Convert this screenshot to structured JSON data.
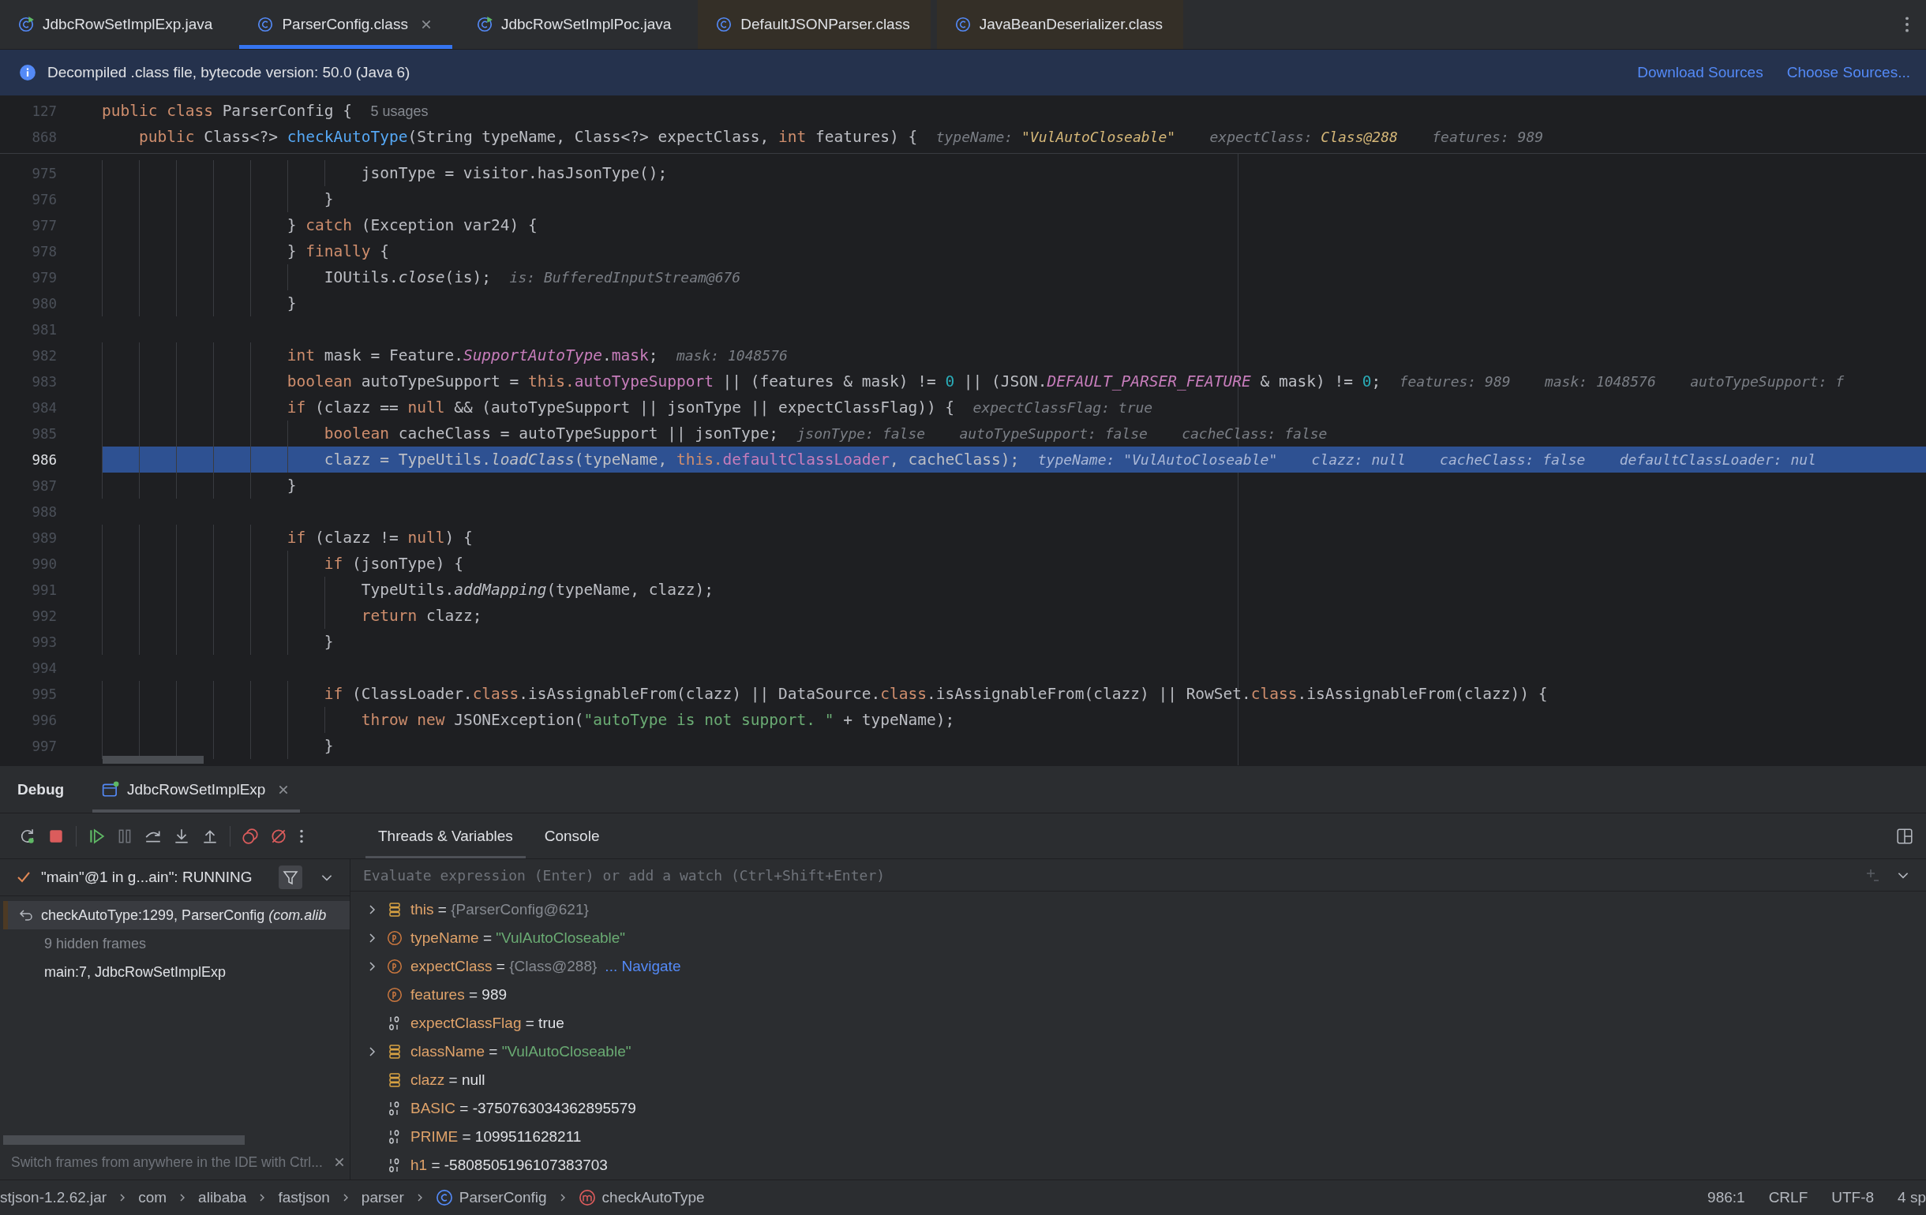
{
  "tabs": [
    {
      "label": "JdbcRowSetImplExp.java",
      "kind": "java",
      "selected": false,
      "closable": false,
      "color": "#2b2d30"
    },
    {
      "label": "ParserConfig.class",
      "kind": "class",
      "selected": true,
      "closable": true,
      "color": "#2b2d30"
    },
    {
      "label": "JdbcRowSetImplPoc.java",
      "kind": "java",
      "selected": false,
      "closable": false,
      "color": "#2b2d30"
    },
    {
      "label": "DefaultJSONParser.class",
      "kind": "class",
      "selected": false,
      "closable": false,
      "color": "#342f27"
    },
    {
      "label": "JavaBeanDeserializer.class",
      "kind": "class",
      "selected": false,
      "closable": false,
      "color": "#342f27"
    }
  ],
  "banner": {
    "text": "Decompiled .class file, bytecode version: 50.0 (Java 6)",
    "links": [
      "Download Sources",
      "Choose Sources..."
    ]
  },
  "sticky_lines": [
    {
      "number": "127",
      "tokens": [
        {
          "text": "public class",
          "kind": "kw"
        },
        {
          "text": " ParserConfig {",
          "kind": "plain"
        },
        {
          "text": "5 usages",
          "kind": "usage"
        }
      ]
    },
    {
      "number": "868",
      "tokens": [
        {
          "text": "    public",
          "kind": "kw"
        },
        {
          "text": " Class<?> ",
          "kind": "plain"
        },
        {
          "text": "checkAutoType",
          "kind": "decl"
        },
        {
          "text": "(String typeName, Class<?> expectClass, ",
          "kind": "plain"
        },
        {
          "text": "int",
          "kind": "kw"
        },
        {
          "text": " features) {",
          "kind": "plain"
        },
        {
          "text": "typeName: ",
          "kind": "hint"
        },
        {
          "text": "\"VulAutoCloseable\"",
          "kind": "hintval"
        },
        {
          "text": "    expectClass: ",
          "kind": "hint"
        },
        {
          "text": "Class@288",
          "kind": "hintval"
        },
        {
          "text": "    features: 989",
          "kind": "hint"
        }
      ]
    }
  ],
  "lines": [
    {
      "number": "975",
      "current": false,
      "tokens": [
        {
          "text": "                            jsonType = visitor.hasJsonType();",
          "kind": "plain"
        }
      ]
    },
    {
      "number": "976",
      "current": false,
      "tokens": [
        {
          "text": "                        }",
          "kind": "plain"
        }
      ]
    },
    {
      "number": "977",
      "current": false,
      "tokens": [
        {
          "text": "                    } ",
          "kind": "plain"
        },
        {
          "text": "catch",
          "kind": "kw"
        },
        {
          "text": " (Exception var24) {",
          "kind": "plain"
        }
      ]
    },
    {
      "number": "978",
      "current": false,
      "tokens": [
        {
          "text": "                    } ",
          "kind": "plain"
        },
        {
          "text": "finally",
          "kind": "kw"
        },
        {
          "text": " {",
          "kind": "plain"
        }
      ]
    },
    {
      "number": "979",
      "current": false,
      "tokens": [
        {
          "text": "                        IOUtils.",
          "kind": "plain"
        },
        {
          "text": "close",
          "kind": "smethod"
        },
        {
          "text": "(is);",
          "kind": "plain"
        },
        {
          "text": "is: BufferedInputStream@676",
          "kind": "hint"
        }
      ]
    },
    {
      "number": "980",
      "current": false,
      "tokens": [
        {
          "text": "                    }",
          "kind": "plain"
        }
      ]
    },
    {
      "number": "981",
      "current": false
    },
    {
      "number": "982",
      "current": false,
      "tokens": [
        {
          "text": "                    int",
          "kind": "kw"
        },
        {
          "text": " mask = Feature.",
          "kind": "plain"
        },
        {
          "text": "SupportAutoType",
          "kind": "sfield"
        },
        {
          "text": ".",
          "kind": "plain"
        },
        {
          "text": "mask",
          "kind": "field"
        },
        {
          "text": ";",
          "kind": "plain"
        },
        {
          "text": "mask: 1048576",
          "kind": "hint"
        }
      ]
    },
    {
      "number": "983",
      "current": false,
      "tokens": [
        {
          "text": "                    boolean",
          "kind": "kw"
        },
        {
          "text": " autoTypeSupport = ",
          "kind": "plain"
        },
        {
          "text": "this.",
          "kind": "kw"
        },
        {
          "text": "autoTypeSupport",
          "kind": "field"
        },
        {
          "text": " || (features & mask) != ",
          "kind": "plain"
        },
        {
          "text": "0",
          "kind": "num"
        },
        {
          "text": " || (JSON.",
          "kind": "plain"
        },
        {
          "text": "DEFAULT_PARSER_FEATURE",
          "kind": "sfield"
        },
        {
          "text": " & mask) != ",
          "kind": "plain"
        },
        {
          "text": "0",
          "kind": "num"
        },
        {
          "text": ";",
          "kind": "plain"
        },
        {
          "text": "features: 989    mask: 1048576    autoTypeSupport: f",
          "kind": "hint"
        }
      ]
    },
    {
      "number": "984",
      "current": false,
      "tokens": [
        {
          "text": "                    if",
          "kind": "kw"
        },
        {
          "text": " (clazz == ",
          "kind": "plain"
        },
        {
          "text": "null",
          "kind": "kw"
        },
        {
          "text": " && (autoTypeSupport || jsonType || expectClassFlag)) {",
          "kind": "plain"
        },
        {
          "text": "expectClassFlag: true",
          "kind": "hint"
        }
      ]
    },
    {
      "number": "985",
      "current": false,
      "tokens": [
        {
          "text": "                        boolean",
          "kind": "kw"
        },
        {
          "text": " cacheClass = autoTypeSupport || jsonType;",
          "kind": "plain"
        },
        {
          "text": "jsonType: false    autoTypeSupport: false    cacheClass: false",
          "kind": "hint"
        }
      ]
    },
    {
      "number": "986",
      "current": true,
      "tokens": [
        {
          "text": "                        clazz = TypeUtils.",
          "kind": "plain"
        },
        {
          "text": "loadClass",
          "kind": "smethod"
        },
        {
          "text": "(typeName, ",
          "kind": "plain"
        },
        {
          "text": "this.",
          "kind": "kw"
        },
        {
          "text": "defaultClassLoader",
          "kind": "field"
        },
        {
          "text": ", cacheClass);",
          "kind": "plain"
        },
        {
          "text": "typeName: \"VulAutoCloseable\"    clazz: null    cacheClass: false    defaultClassLoader: nul",
          "kind": "hint"
        }
      ]
    },
    {
      "number": "987",
      "current": false,
      "tokens": [
        {
          "text": "                    }",
          "kind": "plain"
        }
      ]
    },
    {
      "number": "988",
      "current": false
    },
    {
      "number": "989",
      "current": false,
      "tokens": [
        {
          "text": "                    if",
          "kind": "kw"
        },
        {
          "text": " (clazz != ",
          "kind": "plain"
        },
        {
          "text": "null",
          "kind": "kw"
        },
        {
          "text": ") {",
          "kind": "plain"
        }
      ]
    },
    {
      "number": "990",
      "current": false,
      "tokens": [
        {
          "text": "                        if",
          "kind": "kw"
        },
        {
          "text": " (jsonType) {",
          "kind": "plain"
        }
      ]
    },
    {
      "number": "991",
      "current": false,
      "tokens": [
        {
          "text": "                            TypeUtils.",
          "kind": "plain"
        },
        {
          "text": "addMapping",
          "kind": "smethod"
        },
        {
          "text": "(typeName, clazz);",
          "kind": "plain"
        }
      ]
    },
    {
      "number": "992",
      "current": false,
      "tokens": [
        {
          "text": "                            return",
          "kind": "kw"
        },
        {
          "text": " clazz;",
          "kind": "plain"
        }
      ]
    },
    {
      "number": "993",
      "current": false,
      "tokens": [
        {
          "text": "                        }",
          "kind": "plain"
        }
      ]
    },
    {
      "number": "994",
      "current": false
    },
    {
      "number": "995",
      "current": false,
      "tokens": [
        {
          "text": "                        if",
          "kind": "kw"
        },
        {
          "text": " (ClassLoader.",
          "kind": "plain"
        },
        {
          "text": "class",
          "kind": "kw"
        },
        {
          "text": ".isAssignableFrom(clazz) || DataSource.",
          "kind": "plain"
        },
        {
          "text": "class",
          "kind": "kw"
        },
        {
          "text": ".isAssignableFrom(clazz) || RowSet.",
          "kind": "plain"
        },
        {
          "text": "class",
          "kind": "kw"
        },
        {
          "text": ".isAssignableFrom(clazz)) {",
          "kind": "plain"
        }
      ]
    },
    {
      "number": "996",
      "current": false,
      "tokens": [
        {
          "text": "                            throw new",
          "kind": "kw"
        },
        {
          "text": " JSONException(",
          "kind": "plain"
        },
        {
          "text": "\"autoType is not support. \"",
          "kind": "str"
        },
        {
          "text": " + typeName);",
          "kind": "plain"
        }
      ]
    },
    {
      "number": "997",
      "current": false,
      "tokens": [
        {
          "text": "                        }",
          "kind": "plain"
        }
      ]
    }
  ],
  "debug": {
    "title": "Debug",
    "session_tab": "JdbcRowSetImplExp",
    "view_tabs": [
      {
        "label": "Threads & Variables",
        "selected": true
      },
      {
        "label": "Console",
        "selected": false
      }
    ],
    "thread": "\"main\"@1 in g...ain\": RUNNING",
    "frames": [
      {
        "text": "checkAutoType:1299, ParserConfig *(com.alib*",
        "kind": "frame",
        "selected": true
      },
      {
        "text": "9 hidden frames",
        "kind": "hidden",
        "selected": false
      },
      {
        "text": "main:7, JdbcRowSetImplExp",
        "kind": "frame",
        "selected": false
      }
    ],
    "frames_hint": "Switch frames from anywhere in the IDE with Ctrl...",
    "evaluate": {
      "placeholder": "Evaluate expression (Enter) or add a watch (Ctrl+Shift+Enter)"
    },
    "variables": [
      {
        "name": "this",
        "operator": "=",
        "value": "{ParserConfig@621}",
        "kind": "field",
        "color": "#868a91",
        "expandable": true
      },
      {
        "name": "typeName",
        "operator": "=",
        "value": "\"VulAutoCloseable\"",
        "kind": "param",
        "color": "#6aab73",
        "expandable": true
      },
      {
        "name": "expectClass",
        "operator": "=",
        "value": "{Class@288}",
        "kind": "param",
        "color": "#868a91",
        "expandable": true,
        "link": "... Navigate"
      },
      {
        "name": "features",
        "operator": "=",
        "value": "989",
        "kind": "param",
        "color": "#dfe1e5",
        "expandable": false
      },
      {
        "name": "expectClassFlag",
        "operator": "=",
        "value": "true",
        "kind": "primitive",
        "color": "#dfe1e5",
        "expandable": false
      },
      {
        "name": "className",
        "operator": "=",
        "value": "\"VulAutoCloseable\"",
        "kind": "field",
        "color": "#6aab73",
        "expandable": true
      },
      {
        "name": "clazz",
        "operator": "=",
        "value": "null",
        "kind": "field",
        "color": "#dfe1e5",
        "expandable": false
      },
      {
        "name": "BASIC",
        "operator": "=",
        "value": "-3750763034362895579",
        "kind": "primitive",
        "color": "#dfe1e5",
        "expandable": false
      },
      {
        "name": "PRIME",
        "operator": "=",
        "value": "1099511628211",
        "kind": "primitive",
        "color": "#dfe1e5",
        "expandable": false
      },
      {
        "name": "h1",
        "operator": "=",
        "value": "-5808505196107383703",
        "kind": "primitive",
        "color": "#dfe1e5",
        "expandable": false
      }
    ]
  },
  "status_bar": {
    "breadcrumbs": [
      {
        "text": "stjson-1.2.62.jar",
        "kind": "plain"
      },
      {
        "text": "com",
        "kind": "plain"
      },
      {
        "text": "alibaba",
        "kind": "plain"
      },
      {
        "text": "fastjson",
        "kind": "plain"
      },
      {
        "text": "parser",
        "kind": "plain"
      },
      {
        "text": "ParserConfig",
        "kind": "class"
      },
      {
        "text": "checkAutoType",
        "kind": "method"
      }
    ],
    "items": [
      "986:1",
      "CRLF",
      "UTF-8",
      "4 sp"
    ]
  }
}
